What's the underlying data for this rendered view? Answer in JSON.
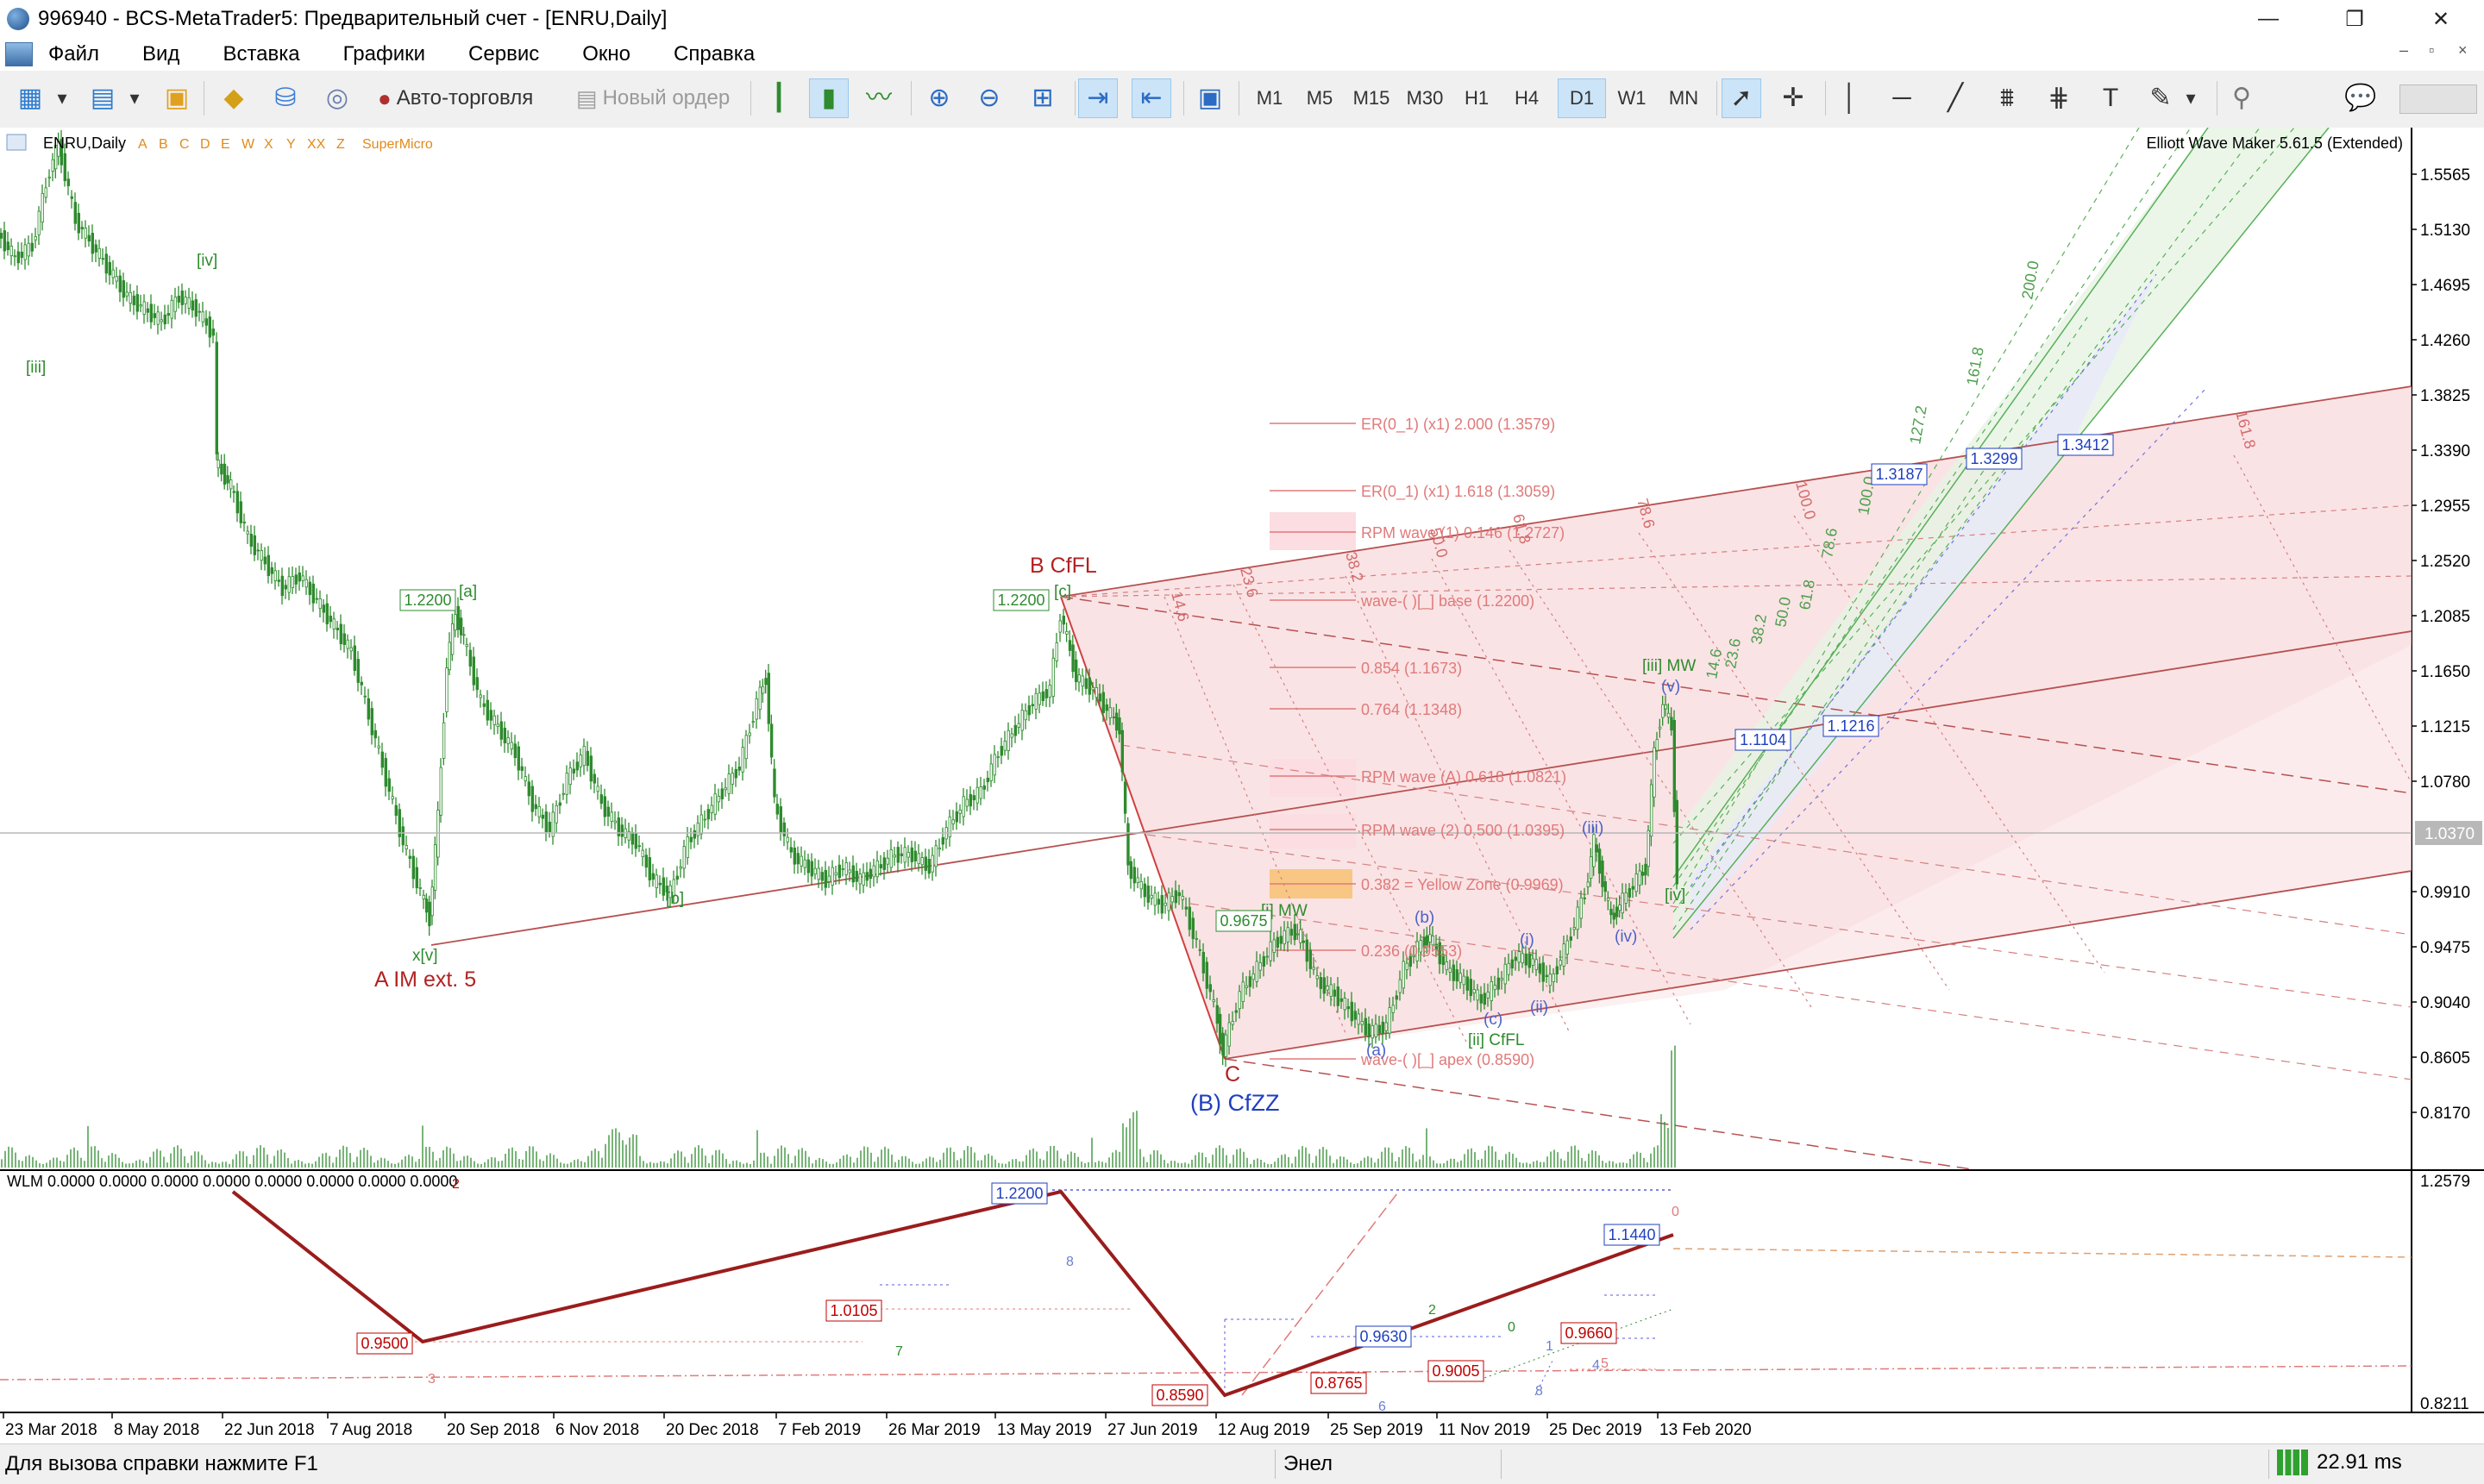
{
  "window": {
    "title": "996940 - BCS-MetaTrader5: Предварительный счет - [ENRU,Daily]",
    "controls": [
      "—",
      "❐",
      "✕"
    ]
  },
  "menu": {
    "items": [
      "Файл",
      "Вид",
      "Вставка",
      "Графики",
      "Сервис",
      "Окно",
      "Справка"
    ],
    "mdi_controls": [
      "–",
      "▫",
      "×"
    ]
  },
  "toolbar": {
    "autotrading_label": "Авто-торговля",
    "new_order_label": "Новый ордер",
    "periods": [
      "M1",
      "M5",
      "M15",
      "M30",
      "H1",
      "H4",
      "D1",
      "W1",
      "MN"
    ],
    "active_period": "D1"
  },
  "chart": {
    "symbol_label": "ENRU,Daily",
    "wave_letters": [
      "A",
      "B",
      "C",
      "D",
      "E",
      "W",
      "X",
      "Y",
      "XX",
      "Z"
    ],
    "wave_letters_extra": "SuperMicro",
    "indicator_label": "Elliott Wave Maker 5.61.5 (Extended)",
    "price_axis": [
      "1.5565",
      "1.5130",
      "1.4695",
      "1.4260",
      "1.3825",
      "1.3390",
      "1.2955",
      "1.2520",
      "1.2085",
      "1.1650",
      "1.1215",
      "1.0780",
      "0.9910",
      "0.9475",
      "0.9040",
      "0.8605",
      "0.8170"
    ],
    "current_price": "1.0370",
    "sub_axis": [
      "1.2579",
      "0.8211"
    ],
    "time_axis": [
      "23 Mar 2018",
      "8 May 2018",
      "22 Jun 2018",
      "7 Aug 2018",
      "20 Sep 2018",
      "6 Nov 2018",
      "20 Dec 2018",
      "7 Feb 2019",
      "26 Mar 2019",
      "13 May 2019",
      "27 Jun 2019",
      "12 Aug 2019",
      "25 Sep 2019",
      "11 Nov 2019",
      "25 Dec 2019",
      "13 Feb 2020"
    ],
    "wave_labels": {
      "iii_top": "[iii]",
      "iv_top": "[iv]",
      "a_top": "[a]",
      "b_low": "[b]",
      "c_top": "[c]",
      "xv": "x[v]",
      "a_im": "A IM ext. 5",
      "b_cffl": "B CfFL",
      "c_low": "C",
      "b_cfzz": "(B) CfZZ",
      "i_mw": "[i] MW",
      "ii_cffl": "[ii] CfFL",
      "iii_mw": "[iii] MW",
      "iv_right": "[iv]",
      "a_minor": "(a)",
      "b_minor": "(b)",
      "c_minor": "(c)",
      "i_minor": "(i)",
      "ii_minor": "(ii)",
      "iii_minor": "(iii)",
      "iv_minor": "(iv)",
      "v_minor": "(v)"
    },
    "price_boxes": {
      "a_box": "1.2200",
      "c_box": "1.2200",
      "i_box": "0.9675",
      "box_1": "1.3187",
      "box_2": "1.3299",
      "box_3": "1.3412",
      "box_4": "1.1104",
      "box_5": "1.1216"
    },
    "levels": [
      "ER(0_1) (x1) 2.000 (1.3579)",
      "ER(0_1) (x1) 1.618 (1.3059)",
      "RPM wave (1) 0.146 (1.2727)",
      "wave-( )[_] base (1.2200)",
      "0.854 (1.1673)",
      "0.764 (1.1348)",
      "RPM wave (A) 0.618 (1.0821)",
      "RPM wave (2) 0.500 (1.0395)",
      "0.382 = Yellow Zone (0.9969)",
      "0.236 (0.9553)",
      "wave-( )[_] apex (0.8590)"
    ],
    "fib_fan_labels": [
      "14.6",
      "23.6",
      "38.2",
      "50.0",
      "61.8",
      "78.6",
      "100.0",
      "161.8"
    ],
    "green_fan_labels": [
      "200.0",
      "161.8",
      "127.2",
      "100.0",
      "78.6",
      "61.8",
      "50.0",
      "38.2",
      "23.6",
      "14.6"
    ]
  },
  "subwindow": {
    "label": "WLM 0.0000 0.0000 0.0000 0.0000 0.0000 0.0000 0.0000 0.0000",
    "boxes": [
      "1.2200",
      "1.0105",
      "0.9500",
      "0.8765",
      "0.9005",
      "0.9630",
      "0.9660",
      "1.1440",
      "0.8590"
    ],
    "digits": [
      "2",
      "8",
      "7",
      "3",
      "2",
      "0",
      "1",
      "6",
      "4",
      "0",
      "8",
      "5"
    ]
  },
  "status": {
    "help": "Для вызова справки нажмите F1",
    "profile": "Энел",
    "ping": "22.91 ms"
  },
  "colors": {
    "bull": "#2e8b2e",
    "wave_red": "#b22222",
    "wave_blue": "#1f3fbf",
    "level_pink": "#e07a7a",
    "green_fan": "#58b058"
  }
}
